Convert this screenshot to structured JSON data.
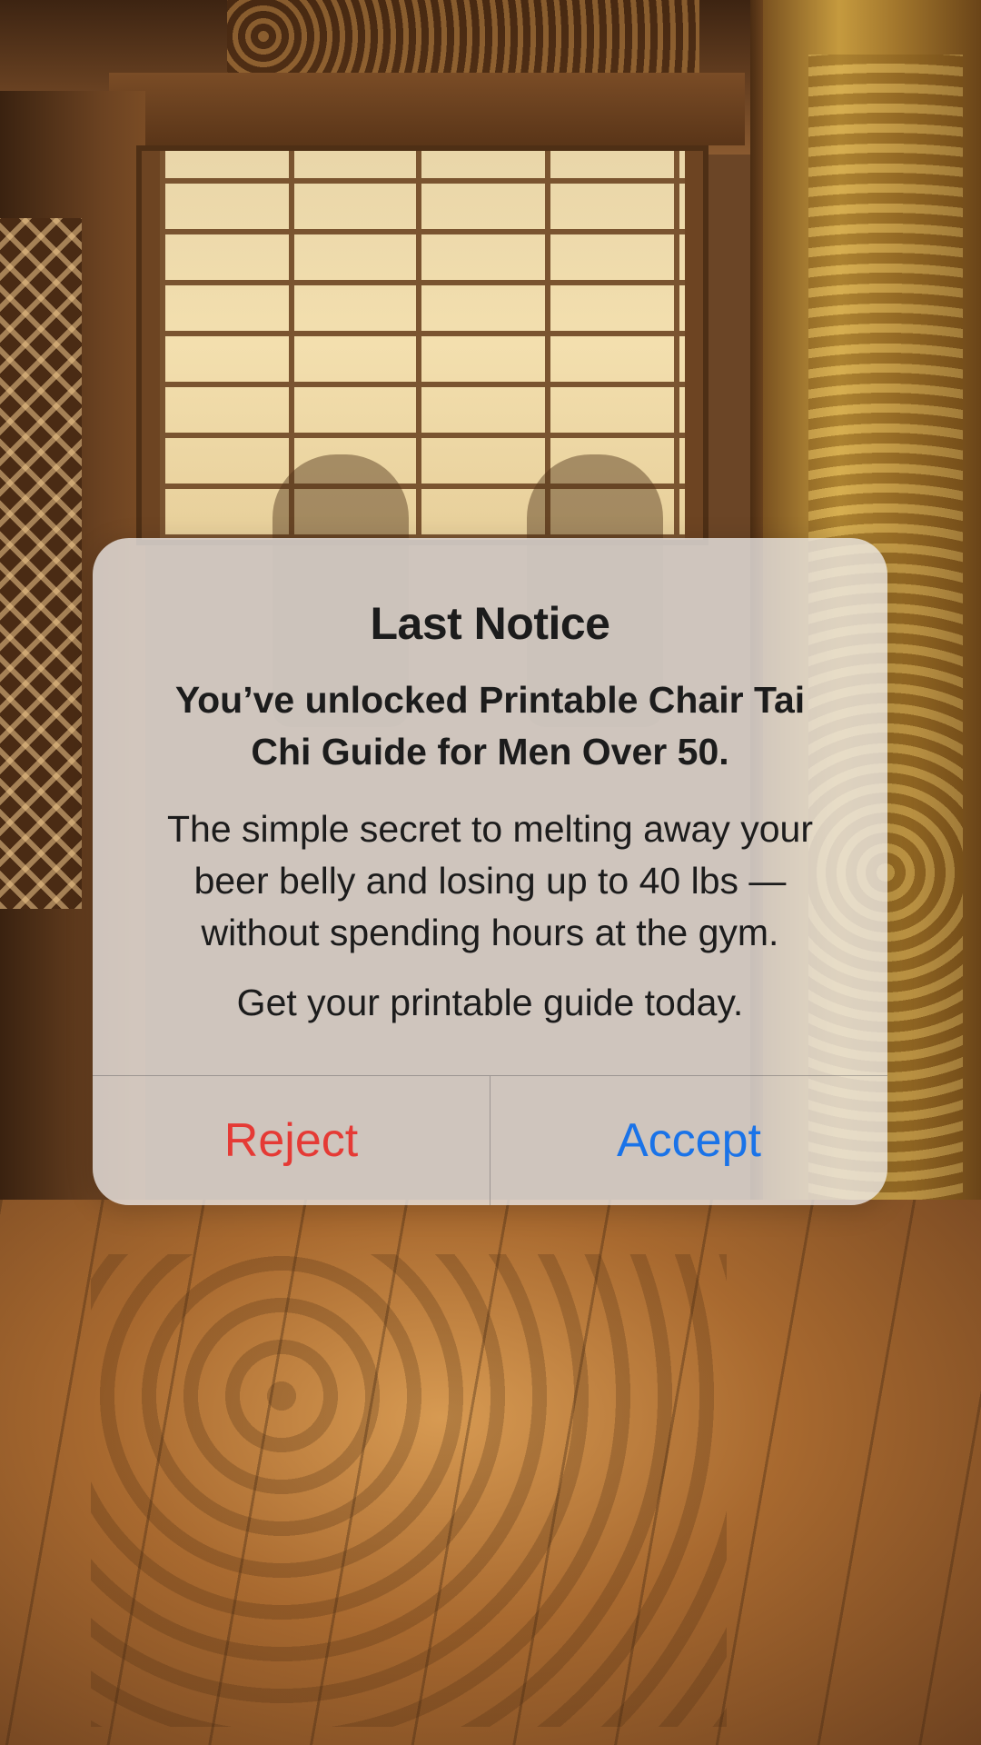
{
  "dialog": {
    "title": "Last Notice",
    "subtitle": "You’ve unlocked Printable Chair Tai Chi Guide for Men Over 50.",
    "message": "The simple secret to melting away your beer belly and losing up to 40 lbs  — without spending hours at the gym.",
    "cta": "Get your printable guide today.",
    "reject_label": "Reject",
    "accept_label": "Accept"
  },
  "colors": {
    "reject": "#e53a35",
    "accept": "#1a73e8",
    "dialog_background": "#ece9e8",
    "text": "#1c1c1c"
  }
}
